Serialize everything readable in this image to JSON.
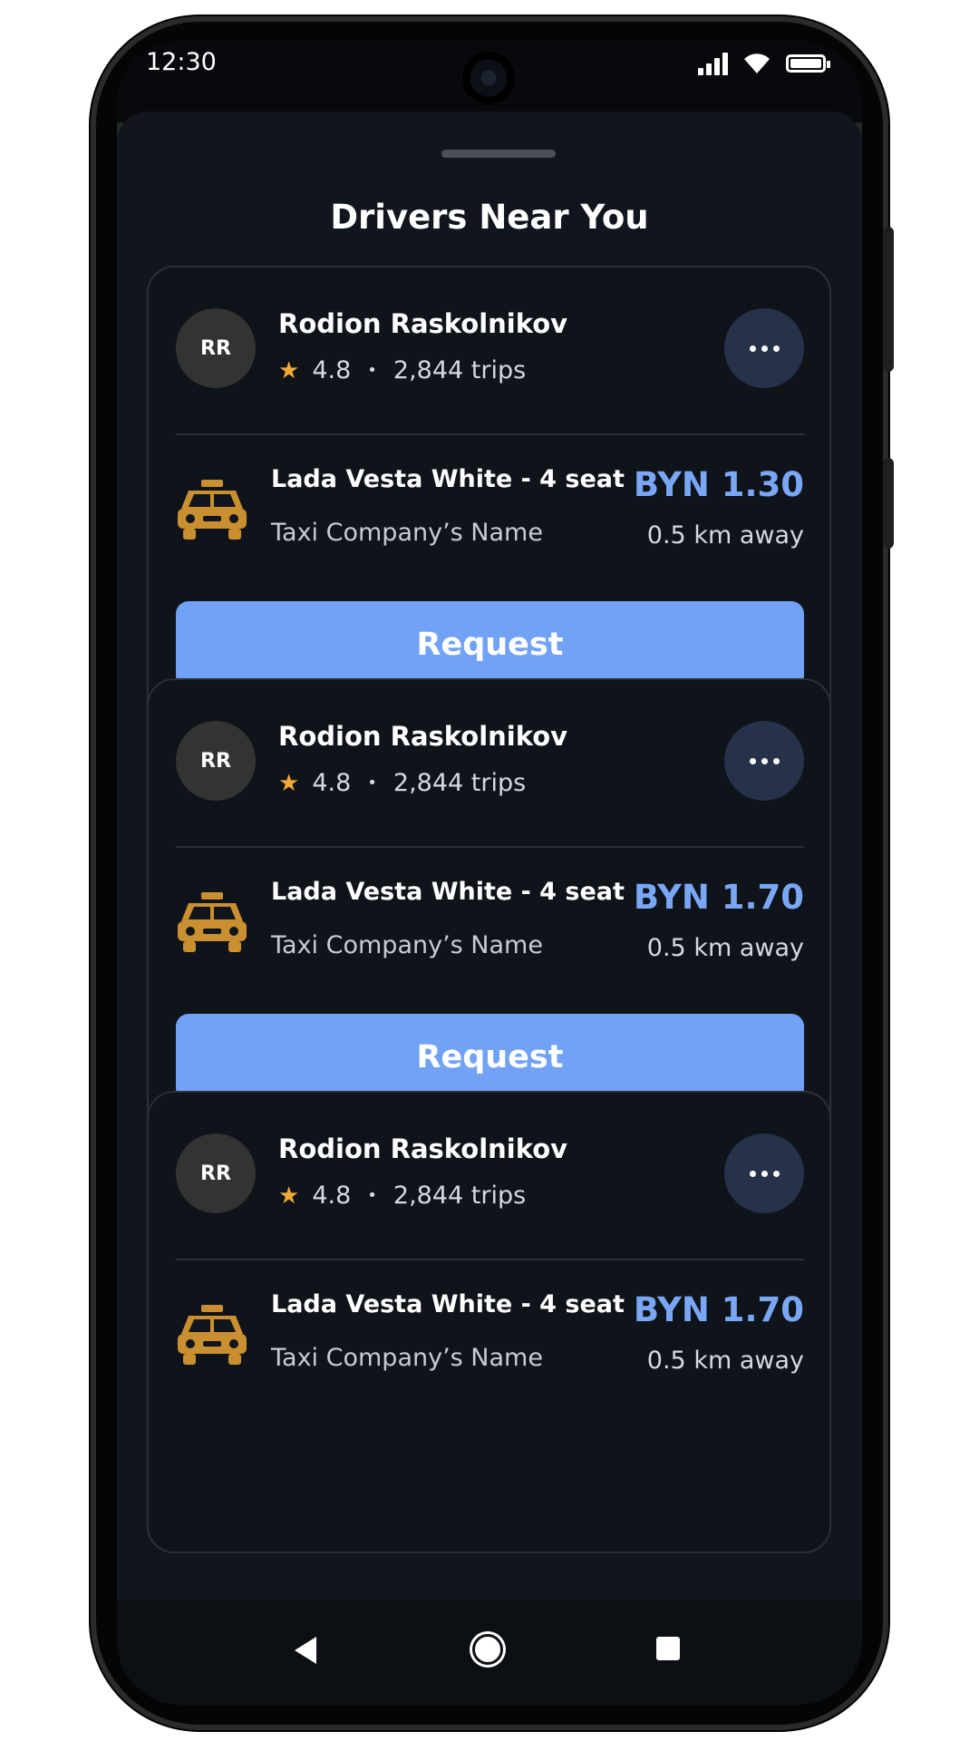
{
  "status_bar": {
    "time": "12:30"
  },
  "sheet": {
    "title": "Drivers Near You"
  },
  "drivers": [
    {
      "initials": "RR",
      "name": "Rodion Raskolnikov",
      "rating": "4.8",
      "trips": "2,844 trips",
      "car": "Lada Vesta White - 4 seat",
      "company": "Taxi Company’s Name",
      "price": "BYN 1.30",
      "distance": "0.5 km away",
      "request_label": "Request"
    },
    {
      "initials": "RR",
      "name": "Rodion Raskolnikov",
      "rating": "4.8",
      "trips": "2,844 trips",
      "car": "Lada Vesta White - 4 seat",
      "company": "Taxi Company’s Name",
      "price": "BYN 1.70",
      "distance": "0.5 km away",
      "request_label": "Request"
    },
    {
      "initials": "RR",
      "name": "Rodion Raskolnikov",
      "rating": "4.8",
      "trips": "2,844 trips",
      "car": "Lada Vesta White - 4 seat",
      "company": "Taxi Company’s Name",
      "price": "BYN 1.70",
      "distance": "0.5 km away"
    }
  ],
  "icons": {
    "star": "star-icon",
    "taxi": "taxi-icon",
    "more": "more-icon",
    "back": "back-icon",
    "home": "home-icon",
    "recents": "recents-icon"
  },
  "colors": {
    "sheet_background": "#11151d",
    "accent_button": "#72a2f5",
    "price": "#7aa7f5",
    "star": "#f3a935",
    "taxi": "#c98f31",
    "more_button": "#26324a"
  }
}
